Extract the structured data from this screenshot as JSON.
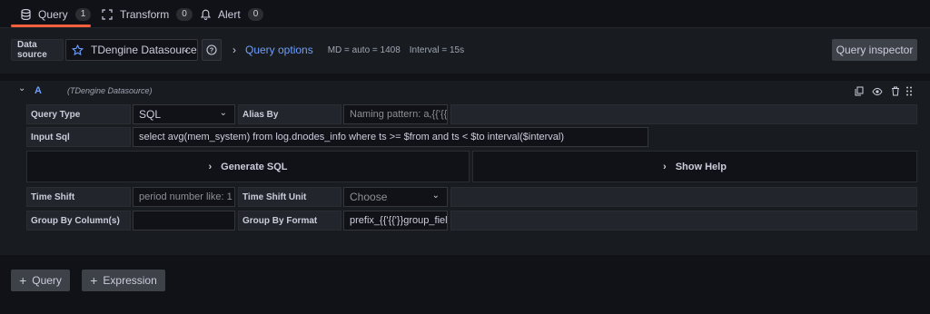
{
  "tabs": [
    {
      "label": "Query",
      "count": "1",
      "icon": "database-icon"
    },
    {
      "label": "Transform",
      "count": "0",
      "icon": "transform-icon"
    },
    {
      "label": "Alert",
      "count": "0",
      "icon": "bell-icon"
    }
  ],
  "toolbar": {
    "datasource_label": "Data source",
    "datasource_value": "TDengine Datasource",
    "query_options_label": "Query options",
    "md_text": "MD = auto = 1408",
    "interval_text": "Interval = 15s",
    "inspector_label": "Query inspector"
  },
  "query": {
    "ref_id": "A",
    "datasource_hint": "(TDengine Datasource)",
    "query_type_label": "Query Type",
    "query_type_value": "SQL",
    "alias_by_label": "Alias By",
    "alias_placeholder": "Naming pattern: a,{{'{{'}}",
    "input_sql_label": "Input Sql",
    "input_sql_value": "select avg(mem_system)  from log.dnodes_info where ts >= $from and ts < $to interval($interval)",
    "generate_sql_label": "Generate SQL",
    "show_help_label": "Show Help",
    "time_shift_label": "Time Shift",
    "time_shift_placeholder": "period number like: 1",
    "time_shift_unit_label": "Time Shift Unit",
    "time_shift_unit_value": "Choose",
    "group_by_column_label": "Group By Column(s)",
    "group_by_column_value": "",
    "group_by_format_label": "Group By Format",
    "group_by_format_value": "prefix_{{'{{'}}group_field"
  },
  "footer": {
    "add_query_label": "Query",
    "add_expression_label": "Expression"
  },
  "colors": {
    "accent_tab": "#f55f3e",
    "link": "#6e9fff",
    "background": "#111217",
    "panel": "#181b1f"
  }
}
